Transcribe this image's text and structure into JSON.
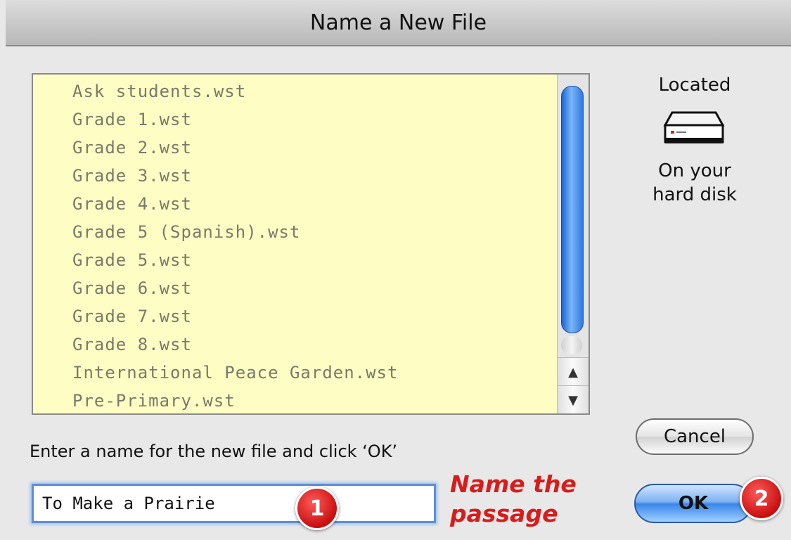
{
  "window": {
    "title": "Name a New File"
  },
  "file_list": {
    "items": [
      "Ask students.wst",
      "Grade 1.wst",
      "Grade 2.wst",
      "Grade 3.wst",
      "Grade 4.wst",
      "Grade 5 (Spanish).wst",
      "Grade 5.wst",
      "Grade 6.wst",
      "Grade 7.wst",
      "Grade 8.wst",
      "International Peace Garden.wst",
      "Pre-Primary.wst"
    ],
    "scroll_up_glyph": "▲",
    "scroll_down_glyph": "▼"
  },
  "location": {
    "label": "Located",
    "icon": "hard-disk-icon",
    "caption_line1": "On your",
    "caption_line2": "hard disk"
  },
  "form": {
    "instruction": "Enter a name for the new file and click ‘OK’",
    "name_value": "To Make a Prairie"
  },
  "annotation": {
    "line1": "Name the",
    "line2": "passage",
    "color": "#d81c1c"
  },
  "badges": {
    "step1": "1",
    "step2": "2",
    "color": "#d21818"
  },
  "buttons": {
    "cancel_label": "Cancel",
    "ok_label": "OK",
    "ok_color": "#3a86e8"
  }
}
